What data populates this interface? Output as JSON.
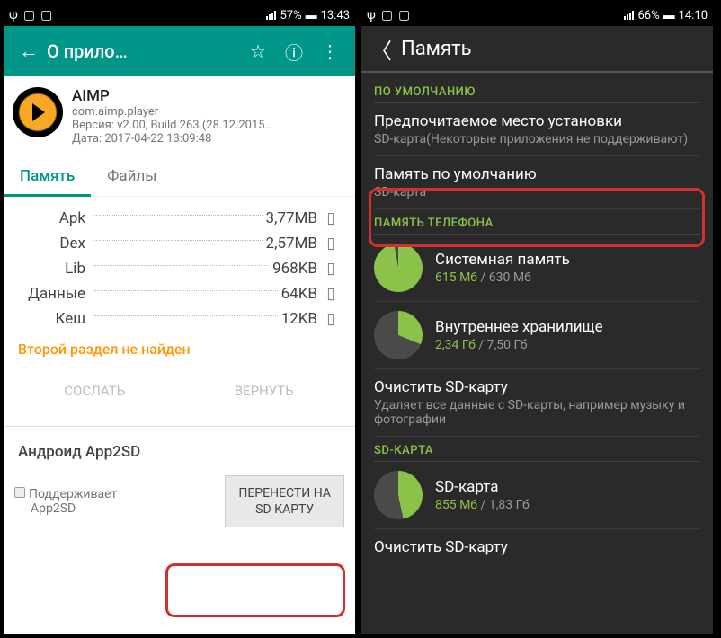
{
  "left": {
    "status": {
      "battery": "57%",
      "time": "13:43"
    },
    "appbar": {
      "title": "О прило…"
    },
    "app": {
      "name": "AIMP",
      "package": "com.aimp.player",
      "version": "Версия: v2.00, Build 263 (28.12.2015…",
      "date": "Дата: 2017-04-22 13:09:48"
    },
    "tabs": {
      "memory": "Память",
      "files": "Файлы"
    },
    "storage": [
      {
        "label": "Apk",
        "value": "3,77MB"
      },
      {
        "label": "Dex",
        "value": "2,57MB"
      },
      {
        "label": "Lib",
        "value": "968KB"
      },
      {
        "label": "Данные",
        "value": "64KB"
      },
      {
        "label": "Кеш",
        "value": "12KB"
      }
    ],
    "warning": "Второй раздел не найден",
    "buttons": {
      "link": "СОСЛАТЬ",
      "revert": "ВЕРНУТЬ"
    },
    "section": "Андроид App2SD",
    "support": {
      "line1": "Поддерживает",
      "line2": "App2SD"
    },
    "move_btn": {
      "line1": "ПЕРЕНЕСТИ НА",
      "line2": "SD КАРТУ"
    }
  },
  "right": {
    "status": {
      "battery": "66%",
      "time": "14:10"
    },
    "header": "Память",
    "sections": {
      "default": "ПО УМОЛЧАНИЮ",
      "phone": "ПАМЯТЬ ТЕЛЕФОНА",
      "sdcard": "SD-КАРТА"
    },
    "pref_install": {
      "title": "Предпочитаемое место установки",
      "sub": "SD-карта(Некоторые приложения не поддерживают)"
    },
    "default_mem": {
      "title": "Память по умолчанию",
      "sub": "SD-карта"
    },
    "system": {
      "name": "Системная память",
      "used": "615 Мб",
      "total": "630 Мб"
    },
    "internal": {
      "name": "Внутреннее хранилище",
      "used": "2,34 Гб",
      "total": "7,50 Гб"
    },
    "clear_sd": {
      "title": "Очистить SD-карту",
      "sub": "Удаляет все данные с SD-карты, например музыку и фотографии"
    },
    "sdcard": {
      "name": "SD-карта",
      "used": "855 Мб",
      "total": "1,83 Гб"
    },
    "clear_sd2": "Очистить SD-карту"
  }
}
